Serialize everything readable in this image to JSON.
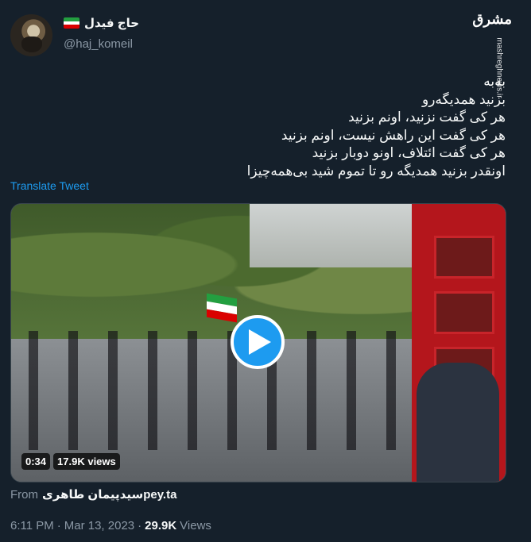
{
  "author": {
    "display_name": "حاج فیدل",
    "handle": "@haj_komeil",
    "avatar_icon": "bearded-man-avatar",
    "flag_icon": "iran-flag-icon"
  },
  "watermark": {
    "logo": "مشرق",
    "site": "mashreghnews.ir"
  },
  "tweet": {
    "lines": [
      "به‌به",
      "بزنید همدیگه‌رو",
      "هر کی گفت نزنید، اونم بزنید",
      "هر کی گفت این راهش نیست، اونم بزنید",
      "هر کی گفت ائتلاف، اونو دوبار بزنید",
      "اونقدر بزنید همدیگه رو تا تموم شید بی‌همه‌چیزا"
    ],
    "translate_label": "Translate Tweet"
  },
  "media": {
    "duration": "0:34",
    "views": "17.9K views",
    "play_icon": "play-icon"
  },
  "source": {
    "from_label": "From",
    "from_name": "سیدپیمان طاهری",
    "from_domain": "pey.ta"
  },
  "meta": {
    "time": "6:11 PM",
    "separator": "·",
    "date": "Mar 13, 2023",
    "view_count": "29.9K",
    "views_label": "Views"
  },
  "colors": {
    "background": "#15202b",
    "text": "#f7f9f9",
    "secondary": "#8b98a5",
    "accent": "#1d9bf0"
  }
}
